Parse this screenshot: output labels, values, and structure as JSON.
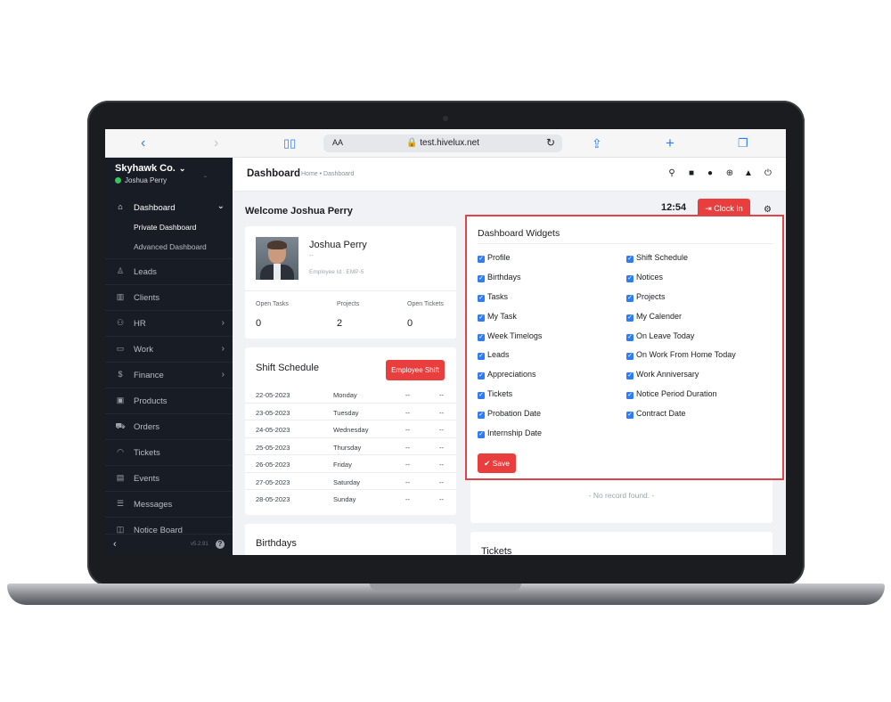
{
  "browser": {
    "url": "test.hivelux.net",
    "text_size_label": "AA",
    "back_icon": "chevron-left-icon",
    "forward_icon": "chevron-right-icon",
    "book_icon": "book-icon",
    "lock_icon": "lock-icon",
    "reload_icon": "reload-icon",
    "share_icon": "share-icon",
    "add_tab_icon": "plus-icon",
    "tabs_icon": "tabs-icon"
  },
  "sidebar": {
    "company": "Skyhawk Co.",
    "user": "Joshua Perry",
    "status_color": "#34c759",
    "dashboard_label": "Dashboard",
    "sub_items": [
      "Private Dashboard",
      "Advanced Dashboard"
    ],
    "items": [
      {
        "label": "Leads",
        "icon": "user-icon",
        "arrow": ""
      },
      {
        "label": "Clients",
        "icon": "building-icon",
        "arrow": ""
      },
      {
        "label": "HR",
        "icon": "people-icon",
        "arrow": "›"
      },
      {
        "label": "Work",
        "icon": "briefcase-icon",
        "arrow": "›"
      },
      {
        "label": "Finance",
        "icon": "dollar-icon",
        "arrow": "›"
      },
      {
        "label": "Products",
        "icon": "box-icon",
        "arrow": ""
      },
      {
        "label": "Orders",
        "icon": "cart-icon",
        "arrow": ""
      },
      {
        "label": "Tickets",
        "icon": "headset-icon",
        "arrow": ""
      },
      {
        "label": "Events",
        "icon": "calendar-icon",
        "arrow": ""
      },
      {
        "label": "Messages",
        "icon": "message-icon",
        "arrow": ""
      },
      {
        "label": "Notice Board",
        "icon": "notice-icon",
        "arrow": ""
      }
    ],
    "version": "v5.2.91"
  },
  "header": {
    "title": "Dashboard",
    "breadcrumb": "Home • Dashboard",
    "icons": [
      "search-icon",
      "sticky-note-icon",
      "clock-icon",
      "plus-circle-icon",
      "bell-icon",
      "power-icon"
    ]
  },
  "welcome": "Welcome Joshua Perry",
  "clock_time": "12:54",
  "clock_in_label": "Clock In",
  "profile": {
    "name": "Joshua Perry",
    "designation": "--",
    "employee_id": "Employee Id : EMP-5",
    "stats": [
      {
        "label": "Open Tasks",
        "value": "0"
      },
      {
        "label": "Projects",
        "value": "2"
      },
      {
        "label": "Open Tickets",
        "value": "0"
      }
    ]
  },
  "shift_schedule": {
    "title": "Shift Schedule",
    "button": "Employee Shift",
    "rows": [
      {
        "date": "22-05-2023",
        "day": "Monday",
        "a": "--",
        "b": "--"
      },
      {
        "date": "23-05-2023",
        "day": "Tuesday",
        "a": "--",
        "b": "--"
      },
      {
        "date": "24-05-2023",
        "day": "Wednesday",
        "a": "--",
        "b": "--"
      },
      {
        "date": "25-05-2023",
        "day": "Thursday",
        "a": "--",
        "b": "--"
      },
      {
        "date": "26-05-2023",
        "day": "Friday",
        "a": "--",
        "b": "--"
      },
      {
        "date": "27-05-2023",
        "day": "Saturday",
        "a": "--",
        "b": "--"
      },
      {
        "date": "28-05-2023",
        "day": "Sunday",
        "a": "--",
        "b": "--"
      }
    ]
  },
  "birthdays_title": "Birthdays",
  "no_record": "- No record found. -",
  "tickets_title": "Tickets",
  "widgets": {
    "title": "Dashboard Widgets",
    "left": [
      "Profile",
      "Birthdays",
      "Tasks",
      "My Task",
      "Week Timelogs",
      "Leads",
      "Appreciations",
      "Tickets",
      "Probation Date",
      "Internship Date"
    ],
    "right": [
      "Shift Schedule",
      "Notices",
      "Projects",
      "My Calender",
      "On Leave Today",
      "On Work From Home Today",
      "Work Anniversary",
      "Notice Period Duration",
      "Contract Date"
    ],
    "save_label": "Save",
    "accent": "#2f7df6",
    "highlight_border": "#e0434a"
  }
}
